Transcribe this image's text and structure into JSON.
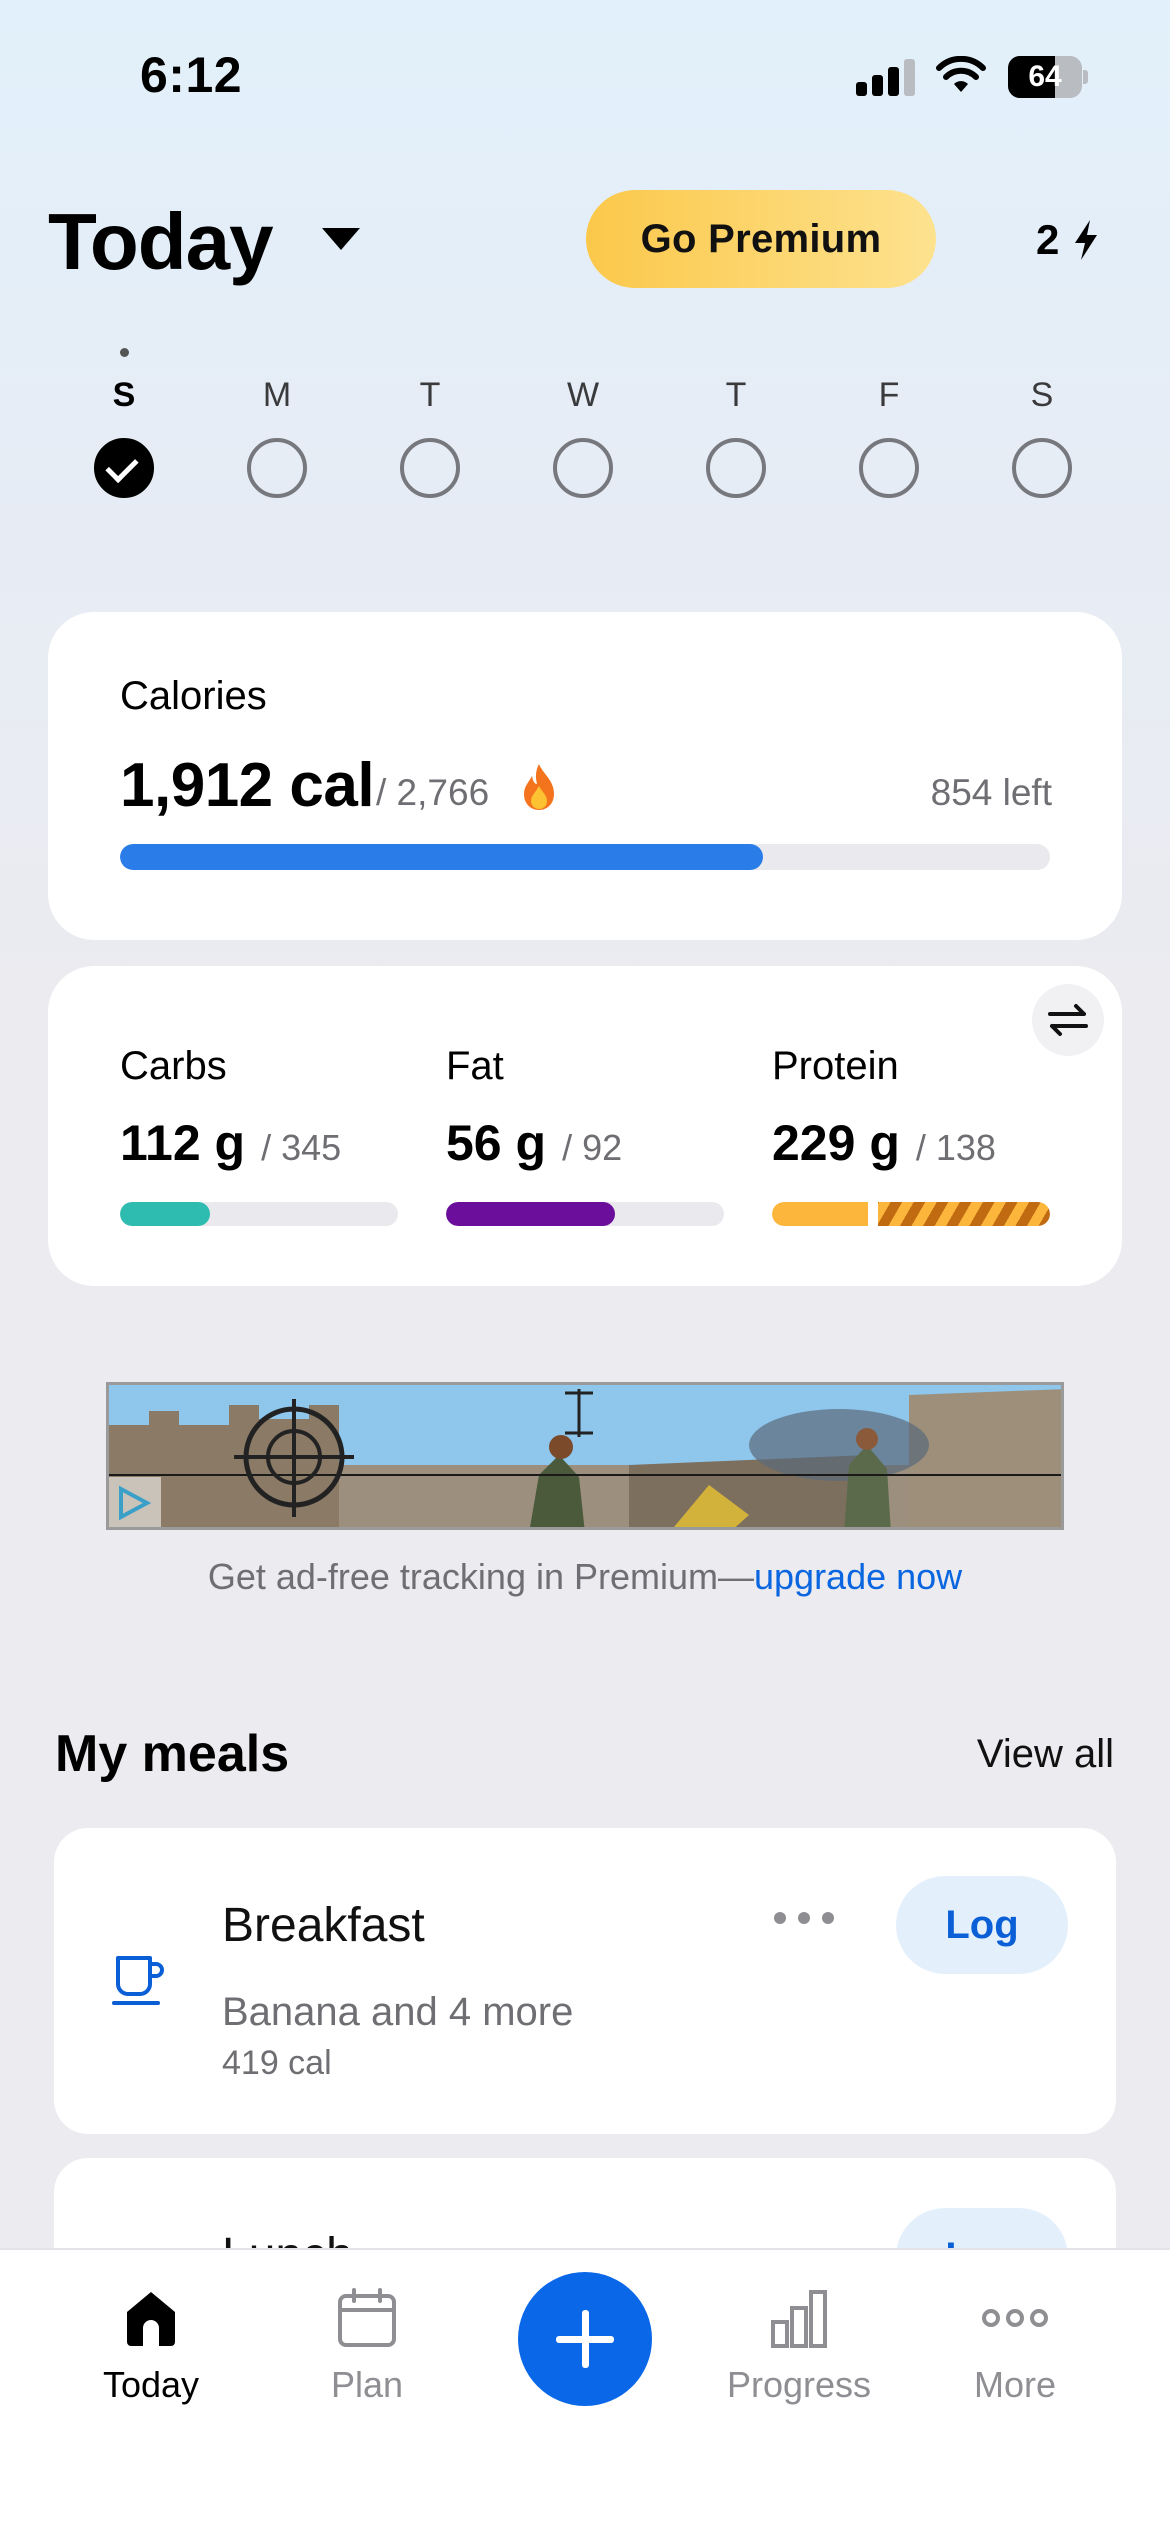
{
  "status_bar": {
    "time": "6:12",
    "battery_percent": "64",
    "battery_level": 0.64
  },
  "header": {
    "title": "Today",
    "premium_label": "Go Premium",
    "streak_count": "2"
  },
  "week": {
    "days": [
      {
        "letter": "S",
        "completed": true,
        "today": true
      },
      {
        "letter": "M",
        "completed": false,
        "today": false
      },
      {
        "letter": "T",
        "completed": false,
        "today": false
      },
      {
        "letter": "W",
        "completed": false,
        "today": false
      },
      {
        "letter": "T",
        "completed": false,
        "today": false
      },
      {
        "letter": "F",
        "completed": false,
        "today": false
      },
      {
        "letter": "S",
        "completed": false,
        "today": false
      }
    ]
  },
  "calories": {
    "label": "Calories",
    "value": "1,912 cal",
    "goal": "/ 2,766",
    "left": "854 left",
    "progress": 0.691,
    "bar_color": "#2a7de9"
  },
  "macros": [
    {
      "name": "Carbs",
      "value": "112 g",
      "goal": "/ 345",
      "progress": 0.325,
      "color": "#2ebbb0"
    },
    {
      "name": "Fat",
      "value": "56 g",
      "goal": "/ 92",
      "progress": 0.609,
      "color": "#6a0e9b"
    },
    {
      "name": "Protein",
      "value": "229 g",
      "goal": "/ 138",
      "progress": 1.0,
      "color": "#fbb63b",
      "over_color": "#c06a12"
    }
  ],
  "ad": {
    "text": "Get ad-free tracking in Premium—",
    "link": "upgrade now"
  },
  "meals": {
    "title": "My meals",
    "view_all": "View all",
    "items": [
      {
        "name": "Breakfast",
        "summary": "Banana and 4 more",
        "calories": "419 cal",
        "log_label": "Log",
        "icon": "coffee-cup-icon"
      },
      {
        "name": "Lunch",
        "log_label": "Log"
      }
    ]
  },
  "tab_bar": {
    "tabs": [
      {
        "label": "Today",
        "icon": "home-icon",
        "active": true
      },
      {
        "label": "Plan",
        "icon": "calendar-icon",
        "active": false
      },
      {
        "label": "Progress",
        "icon": "bar-chart-icon",
        "active": false
      },
      {
        "label": "More",
        "icon": "more-dots-icon",
        "active": false
      }
    ],
    "add_icon": "plus-icon"
  },
  "colors": {
    "accent": "#0a68e8",
    "premium": "#fbc84a",
    "link": "#0a66e0"
  }
}
